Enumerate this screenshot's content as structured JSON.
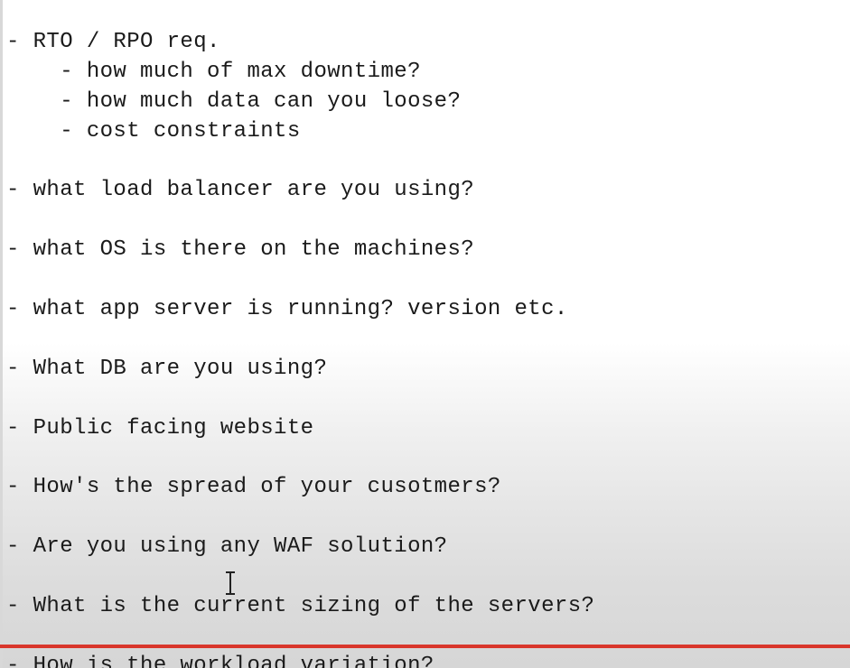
{
  "editor": {
    "lines": [
      "- RTO / RPO req.",
      "    - how much of max downtime?",
      "    - how much data can you loose?",
      "    - cost constraints",
      "",
      "- what load balancer are you using?",
      "",
      "- what OS is there on the machines?",
      "",
      "- what app server is running? version etc.",
      "",
      "- What DB are you using?",
      "",
      "- Public facing website",
      "",
      "- How's the spread of your cusotmers?",
      "",
      "- Are you using any WAF solution?",
      "",
      "- What is the current sizing of the servers?",
      "",
      "- How is the workload variation?"
    ]
  },
  "video": {
    "progress_fraction": 1.0,
    "progress_color": "#d9362b"
  },
  "icons": {
    "cursor": "text-cursor-icon"
  }
}
